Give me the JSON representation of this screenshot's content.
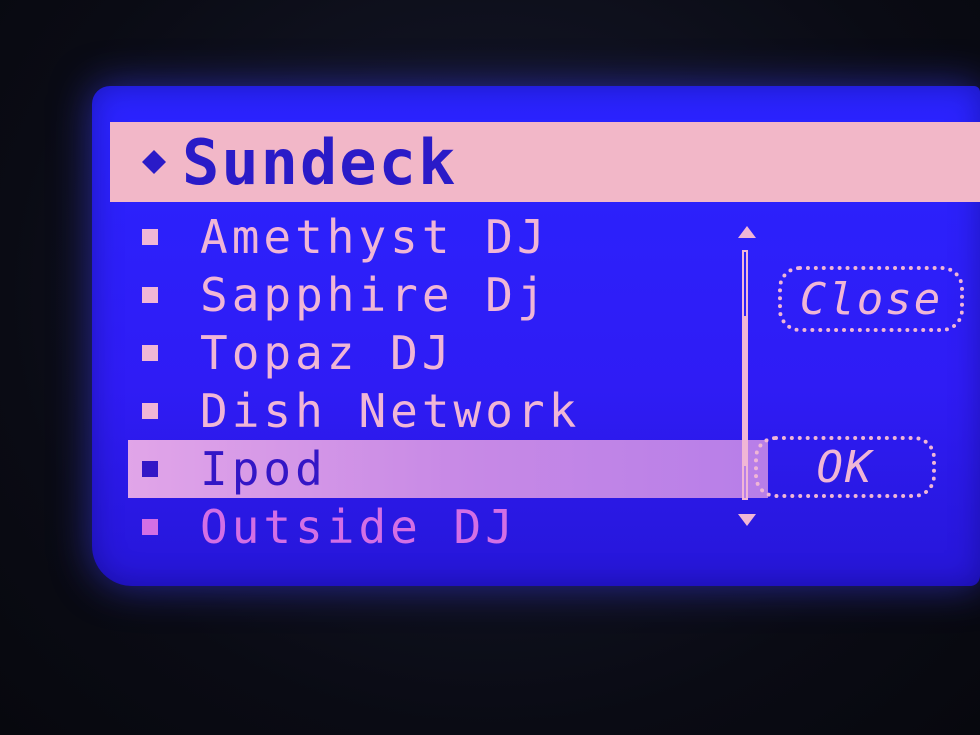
{
  "menu": {
    "title": "Sundeck",
    "items": [
      {
        "label": "Amethyst DJ"
      },
      {
        "label": "Sapphire Dj"
      },
      {
        "label": "Topaz DJ"
      },
      {
        "label": "Dish Network"
      },
      {
        "label": "Ipod"
      },
      {
        "label": "Outside DJ"
      }
    ],
    "selected_index": 4
  },
  "buttons": {
    "close_label": "Close",
    "ok_label": "OK"
  },
  "icons": {
    "header_bullet": "diamond-icon",
    "item_bullet": "square-icon",
    "scroll_up": "arrow-up-icon",
    "scroll_down": "arrow-down-icon"
  },
  "colors": {
    "screen_background": "#2a24ff",
    "text": "#f0b6d6",
    "header_background": "#f2b7c8",
    "selection_background": "#c88ae6"
  }
}
